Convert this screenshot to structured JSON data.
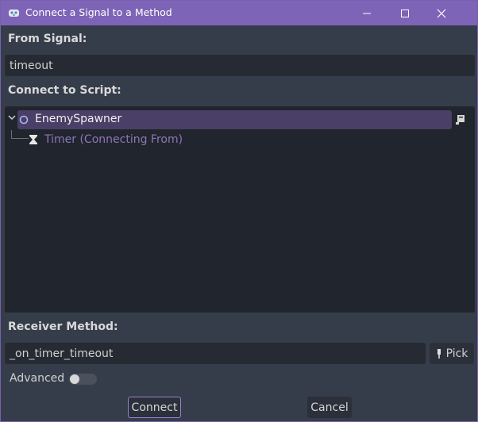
{
  "window": {
    "title": "Connect a Signal to a Method",
    "controls": {
      "minimize": "minimize-icon",
      "maximize": "maximize-icon",
      "close": "close-icon"
    }
  },
  "from_signal": {
    "label": "From Signal:",
    "value": "timeout"
  },
  "connect_to_script": {
    "label": "Connect to Script:",
    "tree": [
      {
        "label": "EnemySpawner",
        "icon": "node-circle-icon",
        "selected": true,
        "expanded": true,
        "has_script": true
      },
      {
        "label": "Timer (Connecting From)",
        "icon": "hourglass-icon",
        "selected": false,
        "dimmed": true
      }
    ]
  },
  "receiver_method": {
    "label": "Receiver Method:",
    "value": "_on_timer_timeout",
    "pick_label": "Pick"
  },
  "advanced": {
    "label": "Advanced",
    "enabled": false
  },
  "buttons": {
    "connect": "Connect",
    "cancel": "Cancel"
  },
  "colors": {
    "accent": "#7e64b6",
    "selection": "#4a3f66",
    "dimmed_text": "#8c76b8",
    "background": "#363d4a"
  }
}
